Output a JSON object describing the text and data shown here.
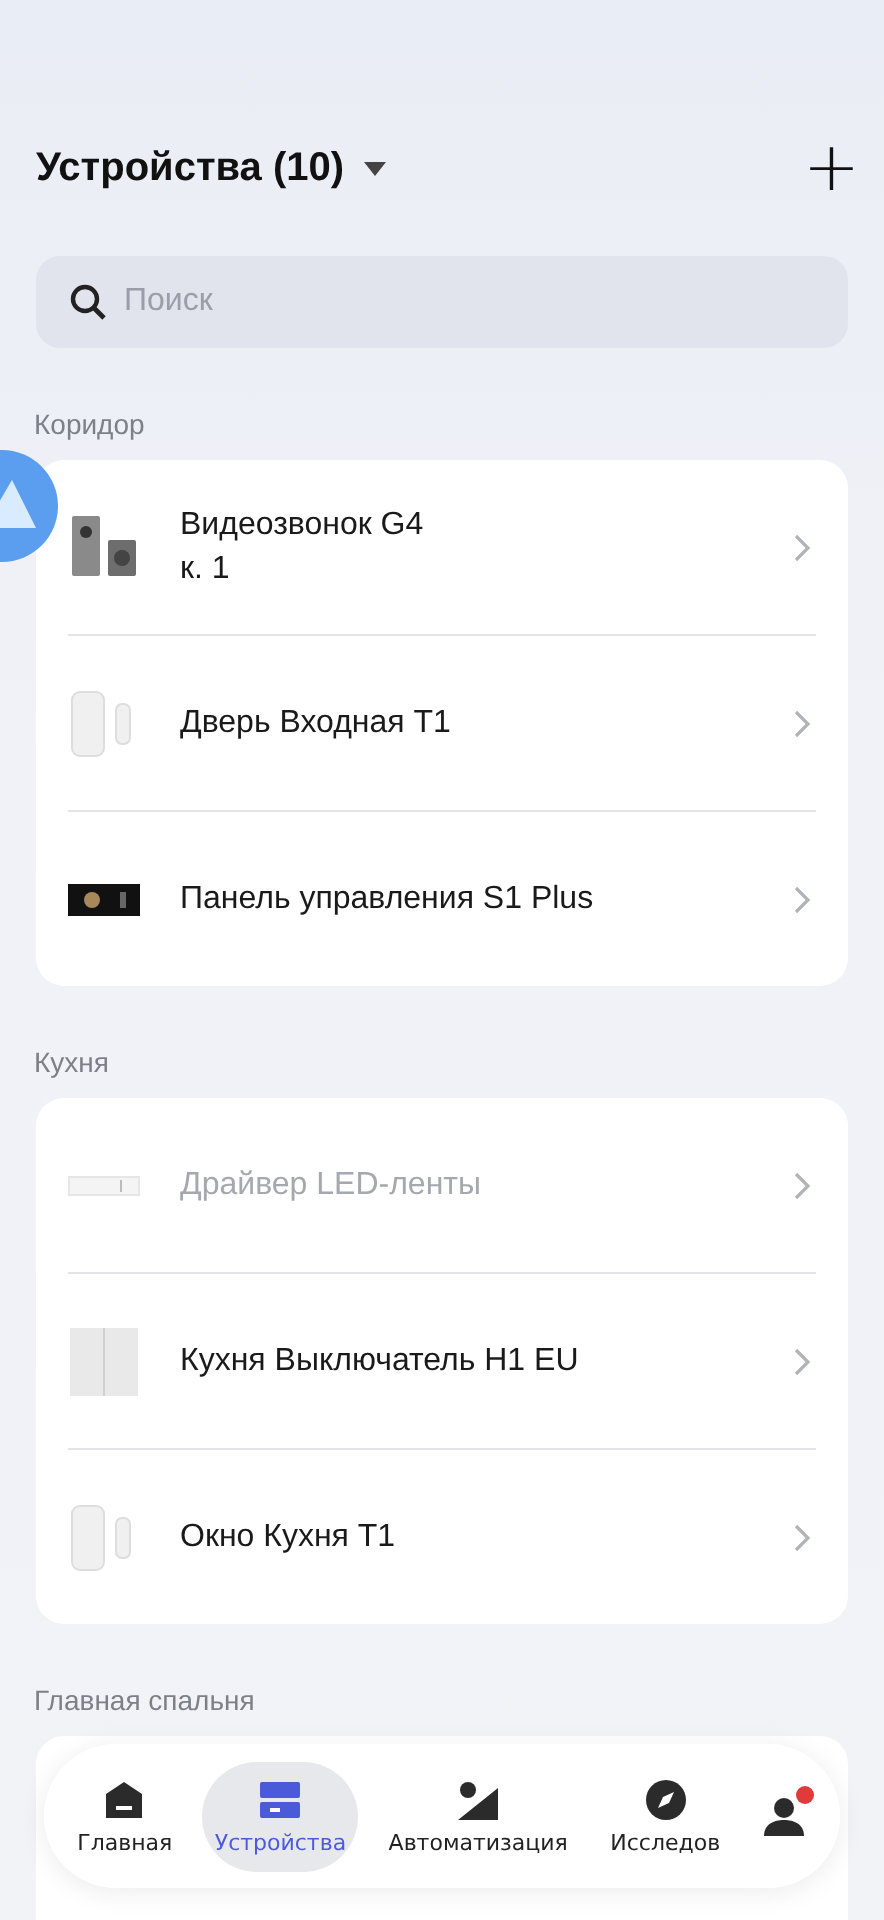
{
  "header": {
    "title": "Устройства (10)",
    "add_button": "+"
  },
  "search": {
    "placeholder": "Поиск"
  },
  "sections": [
    {
      "title": "Коридор",
      "devices": [
        {
          "name": "Видеозвонок G4\nк. 1",
          "kind": "doorbell",
          "offline": false
        },
        {
          "name": "Дверь Входная T1",
          "kind": "sensor",
          "offline": false
        },
        {
          "name": "Панель управления S1 Plus",
          "kind": "panel",
          "offline": false
        }
      ]
    },
    {
      "title": "Кухня",
      "devices": [
        {
          "name": "Драйвер LED-ленты",
          "kind": "led",
          "offline": true
        },
        {
          "name": "Кухня Выключатель H1 EU",
          "kind": "switch",
          "offline": false
        },
        {
          "name": "Окно Кухня T1",
          "kind": "sensor",
          "offline": false
        }
      ]
    },
    {
      "title": "Главная спальня"
    }
  ],
  "tabbar": [
    {
      "label": "Главная",
      "kind": "home",
      "selected": false,
      "badge": false
    },
    {
      "label": "Устройства",
      "kind": "devices",
      "selected": true,
      "badge": false
    },
    {
      "label": "Автоматизация",
      "kind": "automation",
      "selected": false,
      "badge": false
    },
    {
      "label": "Исследов",
      "kind": "explore",
      "selected": false,
      "badge": false
    },
    {
      "kind": "profile",
      "selected": false,
      "badge": true
    }
  ]
}
